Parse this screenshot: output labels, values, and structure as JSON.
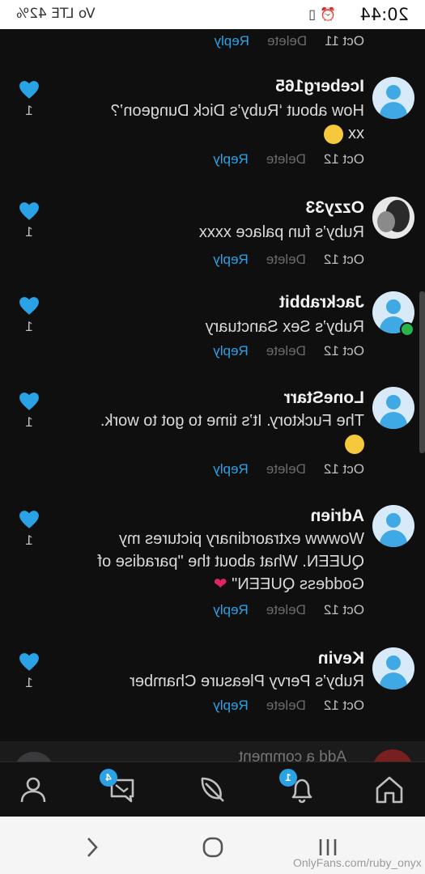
{
  "status": {
    "time": "20:44",
    "battery": "42%",
    "network": "Vo LTE"
  },
  "comments": [
    {
      "user": "",
      "text": "",
      "date": "Oct 11",
      "delete": "Delete",
      "reply": "Reply",
      "likes": "",
      "avatar": "default"
    },
    {
      "user": "Iceberg165",
      "text": "How about ‘Ruby’s Dick Dungeon’? xx",
      "emoji": "grin",
      "date": "Oct 12",
      "delete": "Delete",
      "reply": "Reply",
      "likes": "1",
      "avatar": "default"
    },
    {
      "user": "Ozzy33",
      "text": "Ruby’s fun palace xxxx",
      "date": "Oct 12",
      "delete": "Delete",
      "reply": "Reply",
      "likes": "1",
      "avatar": "photo"
    },
    {
      "user": "Jackrabbit",
      "text": "Ruby’s Sex Sanctuary",
      "date": "Oct 12",
      "delete": "Delete",
      "reply": "Reply",
      "likes": "1",
      "avatar": "default",
      "online": true
    },
    {
      "user": "LoneStarr",
      "text": "The Fucktory. It’s time to got to work.",
      "emoji": "smirk",
      "date": "Oct 12",
      "delete": "Delete",
      "reply": "Reply",
      "likes": "1",
      "avatar": "default"
    },
    {
      "user": "Adrien",
      "text": "Wowww extraordinary pictures my QUEEN. What about the \"paradise of Goddess QUEEN\"",
      "emoji": "red-heart",
      "date": "Oct 12",
      "delete": "Delete",
      "reply": "Reply",
      "likes": "1",
      "avatar": "default"
    },
    {
      "user": "Kevin",
      "text": "Ruby’s Pervy Pleasure Chamber",
      "date": "Oct 12",
      "delete": "Delete",
      "reply": "Reply",
      "likes": "1",
      "avatar": "default"
    }
  ],
  "add_comment": {
    "placeholder": "Add a comment"
  },
  "tabs": [
    {
      "name": "home-icon"
    },
    {
      "name": "bell-icon",
      "badge": "1"
    },
    {
      "name": "feather-icon"
    },
    {
      "name": "messages-icon",
      "badge": "4"
    },
    {
      "name": "profile-icon"
    }
  ],
  "watermark": "OnlyFans.com/ruby_onyx",
  "colors": {
    "accent": "#2aa3e6",
    "background": "#0f0f10"
  }
}
